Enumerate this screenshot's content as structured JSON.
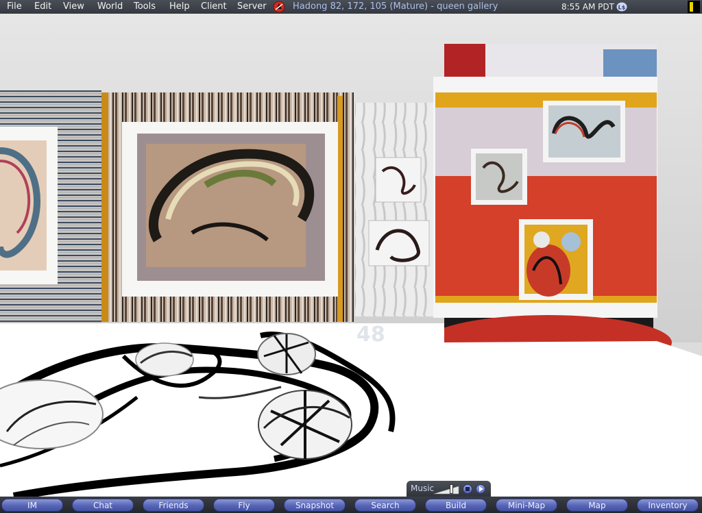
{
  "menubar": {
    "items": [
      "File",
      "Edit",
      "View",
      "World",
      "Tools",
      "Help",
      "Client",
      "Server"
    ],
    "location": "Hadong 82, 172, 105 (Mature) - queen gallery",
    "clock": "8:55 AM PDT",
    "currency_icon": "linden-dollar-icon"
  },
  "scene": {
    "floor_text": "48"
  },
  "music": {
    "label": "Music",
    "volume": 0.7
  },
  "toolbar": {
    "buttons": [
      "IM",
      "Chat",
      "Friends",
      "Fly",
      "Snapshot",
      "Search",
      "Build",
      "Mini-Map",
      "Map",
      "Inventory"
    ]
  }
}
